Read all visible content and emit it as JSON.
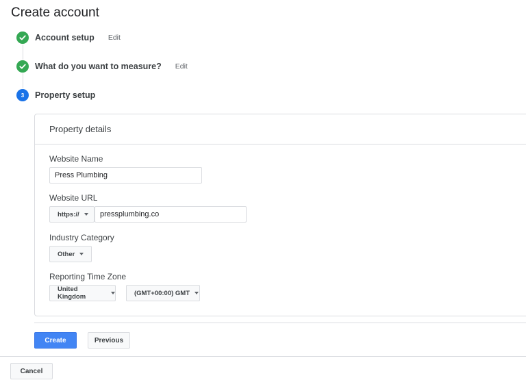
{
  "header": {
    "title": "Create account"
  },
  "steps": [
    {
      "label": "Account setup",
      "status": "complete",
      "edit_label": "Edit"
    },
    {
      "label": "What do you want to measure?",
      "status": "complete",
      "edit_label": "Edit"
    },
    {
      "label": "Property setup",
      "status": "current",
      "number": "3"
    }
  ],
  "property_details": {
    "title": "Property details",
    "website_name": {
      "label": "Website Name",
      "value": "Press Plumbing"
    },
    "website_url": {
      "label": "Website URL",
      "protocol": "https://",
      "value": "pressplumbing.co"
    },
    "industry_category": {
      "label": "Industry Category",
      "value": "Other"
    },
    "reporting_time_zone": {
      "label": "Reporting Time Zone",
      "country": "United Kingdom",
      "zone": "(GMT+00:00) GMT"
    }
  },
  "actions": {
    "create_label": "Create",
    "previous_label": "Previous",
    "cancel_label": "Cancel"
  },
  "colors": {
    "step_complete": "#34a853",
    "step_current": "#1a73e8",
    "primary_button": "#4285f4"
  },
  "icons": {
    "step_complete": "check-icon",
    "dropdown": "caret-down-icon"
  }
}
